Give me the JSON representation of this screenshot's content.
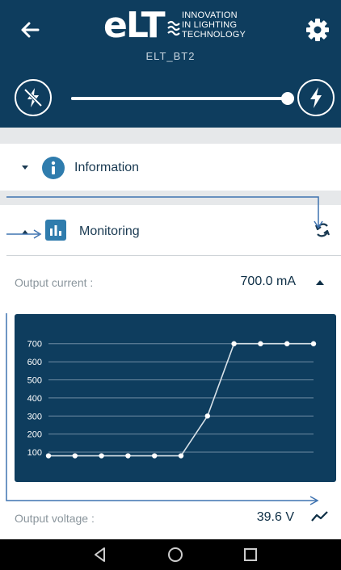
{
  "header": {
    "logo_text": "eLT",
    "logo_tagline": [
      "INNOVATION",
      "IN LIGHTING",
      "TECHNOLOGY"
    ],
    "device_name": "ELT_BT2",
    "back_icon": "arrow-left-icon",
    "settings_icon": "gear-icon",
    "colors": {
      "background": "#0e3d5e",
      "accent": "#2f7cad"
    }
  },
  "dimming": {
    "min_icon": "light-off-icon",
    "max_icon": "light-on-icon",
    "level_percent": 100
  },
  "sections": {
    "information": {
      "label": "Information",
      "icon": "info-icon",
      "expanded": false
    },
    "monitoring": {
      "label": "Monitoring",
      "icon": "bar-chart-icon",
      "expanded": true,
      "refresh_icon": "refresh-icon"
    }
  },
  "measurements": {
    "output_current": {
      "label": "Output current :",
      "value": "700.0 mA",
      "expanded": true
    },
    "output_voltage": {
      "label": "Output voltage :",
      "value": "39.6 V",
      "trend_icon": "trend-icon"
    }
  },
  "chart_data": {
    "type": "line",
    "x": [
      1,
      2,
      3,
      4,
      5,
      6,
      7,
      8,
      9,
      10,
      11
    ],
    "y": [
      80,
      80,
      80,
      80,
      80,
      80,
      300,
      700,
      700,
      700,
      700
    ],
    "yticks": [
      100,
      200,
      300,
      400,
      500,
      600,
      700
    ],
    "ylim": [
      60,
      730
    ],
    "grid": true
  },
  "navbar": {
    "back_icon": "nav-back-icon",
    "home_icon": "nav-home-icon",
    "recents_icon": "nav-recents-icon"
  }
}
